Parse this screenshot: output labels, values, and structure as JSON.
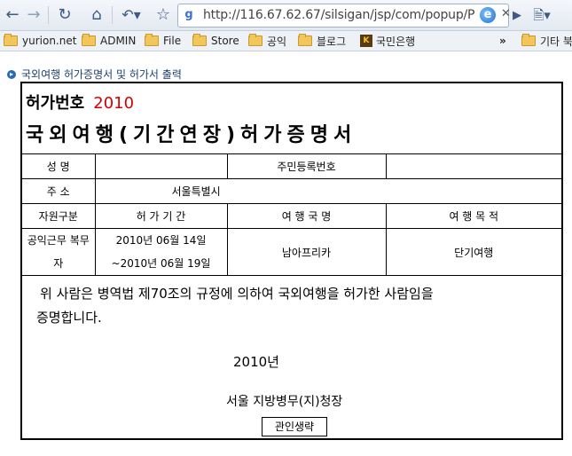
{
  "browser": {
    "url": "http://116.67.62.67/silsigan/jsp/com/popup/P"
  },
  "bookmarks": [
    {
      "label": "yurion.net",
      "icon": "page-icon"
    },
    {
      "label": "ADMIN",
      "icon": "folder-icon"
    },
    {
      "label": "File",
      "icon": "folder-icon"
    },
    {
      "label": "Store",
      "icon": "folder-icon"
    },
    {
      "label": "공익",
      "icon": "folder-icon"
    },
    {
      "label": "블로그",
      "icon": "folder-icon"
    },
    {
      "label": "국민은행",
      "icon": "bank-icon"
    }
  ],
  "bookmarks_more": "»",
  "bookmarks_other": "기타 북",
  "page": {
    "heading": "국외여행 허가증명서 및 허가서 출력"
  },
  "certificate": {
    "permit_label": "허가번호",
    "permit_year": "2010",
    "title": "국외여행(기간연장)허가증명서",
    "labels": {
      "name": "성    명",
      "resident_no": "주민등록번호",
      "address": "주    소",
      "category": "자원구분",
      "period": "허 가 기 간",
      "country": "여 행 국 명",
      "purpose": "여 행 목 적"
    },
    "values": {
      "name": "",
      "resident_no": "",
      "address": "서울특별시",
      "category_line1": "공익근무 복무",
      "category_line2": "자",
      "period_line1": "2010년 06월 14일",
      "period_line2": "~2010년 06월 19일",
      "country": "남아프리카",
      "purpose": "단기여행"
    },
    "statement_line1": "위 사람은 병역법 제70조의 규정에 의하여 국외여행을 허가한 사람임을",
    "statement_line2": "증명합니다.",
    "date_year": "2010년",
    "issuer": "서울 지방병무(지)청장",
    "stamp_button": "관인생략"
  }
}
